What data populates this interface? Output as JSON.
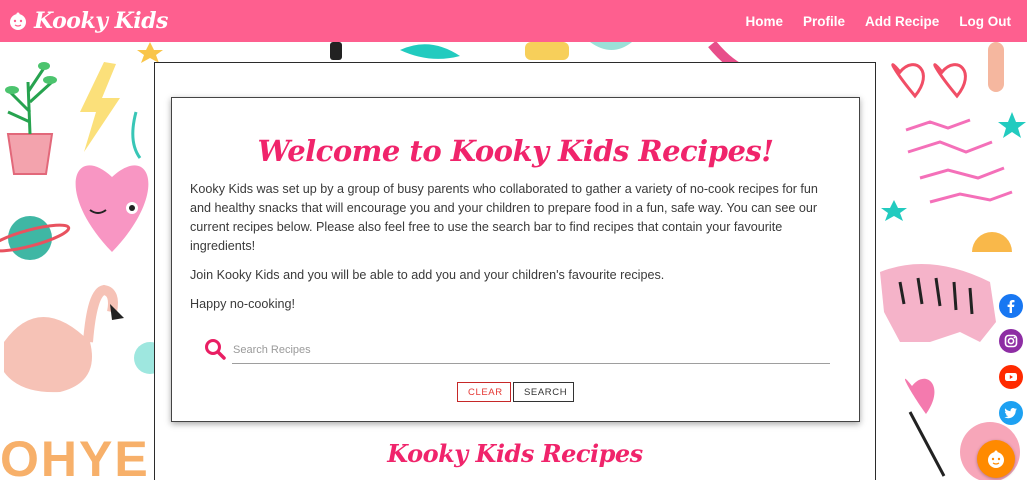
{
  "nav": {
    "brand": "Kooky Kids",
    "links": [
      "Home",
      "Profile",
      "Add Recipe",
      "Log Out"
    ]
  },
  "intro": {
    "heading": "Welcome to Kooky Kids Recipes!",
    "paragraph1": "Kooky Kids was set up by a group of busy parents who collaborated to gather a variety of no-cook recipes for fun and healthy snacks that will encourage you and your children to prepare food in a fun, safe way. You can see our current recipes below. Please also feel free to use the search bar to find recipes that contain your favourite ingredients!",
    "paragraph2": "Join Kooky Kids and you will be able to add you and your children's favourite recipes.",
    "paragraph3": "Happy no-cooking!"
  },
  "search": {
    "placeholder": "Search Recipes",
    "value": "",
    "clear_label": "CLEAR",
    "search_label": "SEARCH"
  },
  "recipes": {
    "title": "Kooky Kids Recipes"
  },
  "background": {
    "lettering_left": "OHYE"
  },
  "social": [
    {
      "name": "facebook-icon",
      "color": "#1877f2"
    },
    {
      "name": "instagram-icon",
      "color": "#8e2da4"
    },
    {
      "name": "youtube-icon",
      "color": "#ff2a00"
    },
    {
      "name": "twitter-icon",
      "color": "#1da1f2"
    }
  ],
  "colors": {
    "brand": "#fe5f8f",
    "accent": "#f0246b",
    "fab": "#ff8a00"
  }
}
